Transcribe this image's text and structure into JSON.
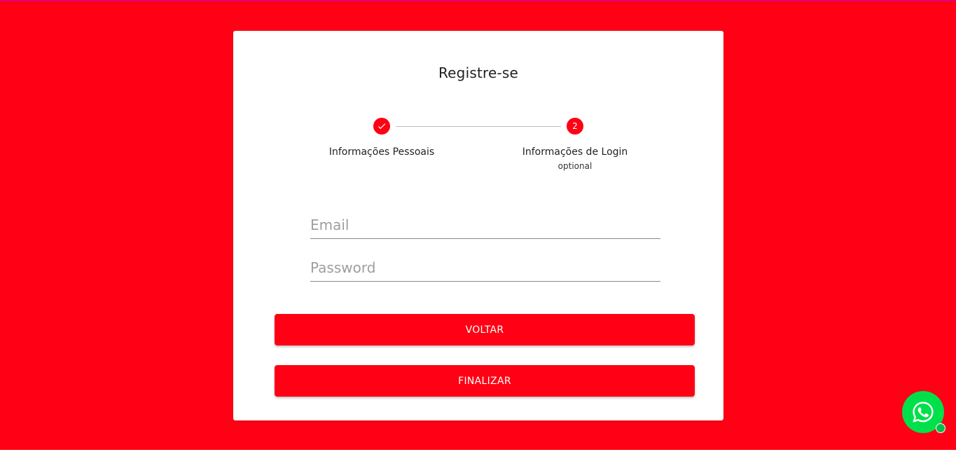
{
  "page": {
    "title": "Registre-se"
  },
  "stepper": {
    "steps": [
      {
        "label": "Informações Pessoais",
        "state": "completed",
        "icon": "check-icon"
      },
      {
        "label": "Informações de Login",
        "number": "2",
        "optional": "optional",
        "state": "active"
      }
    ]
  },
  "form": {
    "email_placeholder": "Email",
    "email_value": "",
    "password_placeholder": "Password",
    "password_value": ""
  },
  "actions": {
    "back_label": "VOLTAR",
    "finish_label": "FINALIZAR"
  },
  "floating": {
    "whatsapp_icon": "whatsapp-icon"
  },
  "colors": {
    "accent": "#ff0014",
    "whatsapp": "#00e04b"
  }
}
